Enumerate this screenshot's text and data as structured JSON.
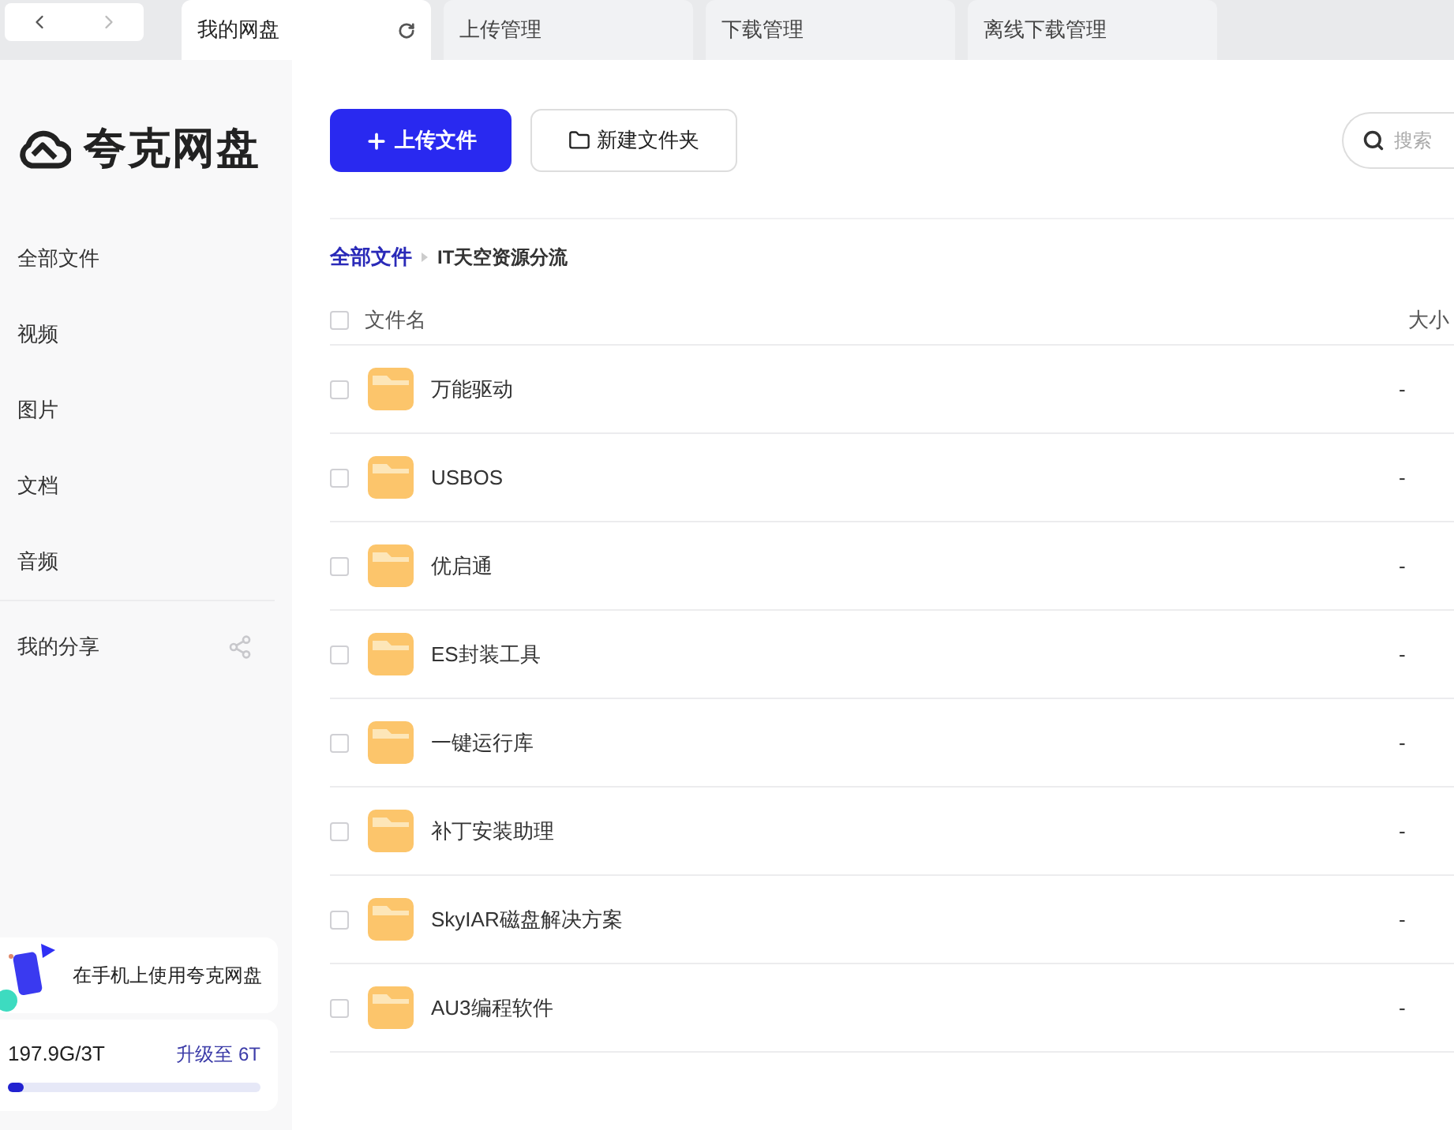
{
  "tabs": [
    {
      "label": "我的网盘",
      "selected": true,
      "refresh": true
    },
    {
      "label": "上传管理",
      "selected": false,
      "refresh": false
    },
    {
      "label": "下载管理",
      "selected": false,
      "refresh": false
    },
    {
      "label": "离线下载管理",
      "selected": false,
      "refresh": false
    }
  ],
  "logo": "夸克网盘",
  "sidebar": {
    "items": [
      {
        "label": "全部文件",
        "kind": "plain"
      },
      {
        "label": "视频",
        "kind": "plain"
      },
      {
        "label": "图片",
        "kind": "plain"
      },
      {
        "label": "文档",
        "kind": "plain"
      },
      {
        "label": "音频",
        "kind": "plain"
      },
      {
        "label": "我的分享",
        "kind": "share"
      }
    ],
    "promo": "在手机上使用夸克网盘",
    "storage": {
      "used": "197.9G/3T",
      "upgrade": "升级至 6T",
      "level": 0.06
    }
  },
  "toolbar": {
    "upload": "上传文件",
    "new_folder": "新建文件夹",
    "search_placeholder": "搜索"
  },
  "breadcrumb": [
    "全部文件",
    "IT天空资源分流"
  ],
  "table": {
    "all_checked": false,
    "columns": [
      "文件名",
      "大小"
    ],
    "rows": [
      {
        "name": "万能驱动",
        "size": "-",
        "checked": false
      },
      {
        "name": "USBOS",
        "size": "-",
        "checked": false
      },
      {
        "name": "优启通",
        "size": "-",
        "checked": false
      },
      {
        "name": "ES封装工具",
        "size": "-",
        "checked": false
      },
      {
        "name": "一键运行库",
        "size": "-",
        "checked": false
      },
      {
        "name": "补丁安装助理",
        "size": "-",
        "checked": false
      },
      {
        "name": "SkyIAR磁盘解决方案",
        "size": "-",
        "checked": false
      },
      {
        "name": "AU3编程软件",
        "size": "-",
        "checked": false
      }
    ]
  }
}
